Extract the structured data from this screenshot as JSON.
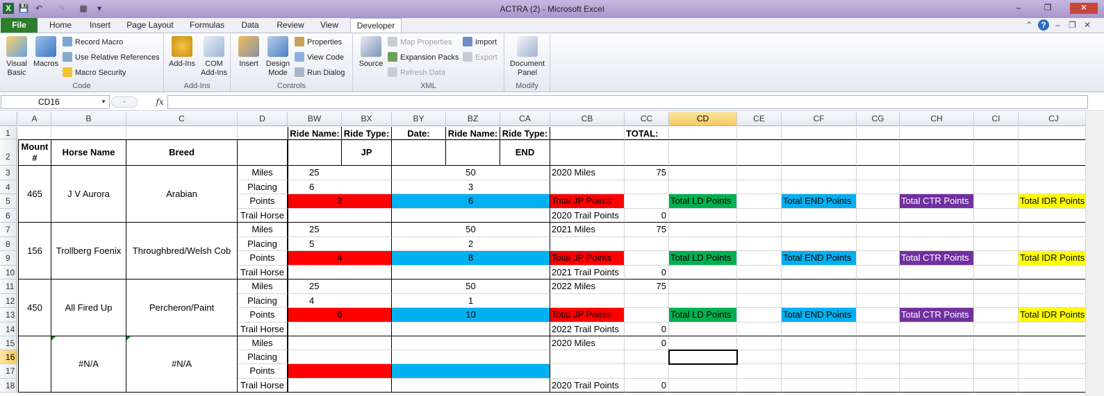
{
  "window": {
    "title": "ACTRA (2)  -  Microsoft Excel"
  },
  "quick_access": {
    "save_icon": "save-icon",
    "undo_icon": "undo-icon",
    "redo_icon": "redo-icon"
  },
  "tabs": [
    "File",
    "Home",
    "Insert",
    "Page Layout",
    "Formulas",
    "Data",
    "Review",
    "View",
    "Developer"
  ],
  "active_tab": "Developer",
  "ribbon": {
    "code": {
      "label": "Code",
      "visual_basic": "Visual\nBasic",
      "macros": "Macros",
      "record_macro": "Record Macro",
      "relative_refs": "Use Relative References",
      "macro_security": "Macro Security"
    },
    "addins": {
      "label": "Add-Ins",
      "addins": "Add-Ins",
      "com_addins": "COM\nAdd-Ins"
    },
    "controls": {
      "label": "Controls",
      "insert": "Insert",
      "design_mode": "Design\nMode",
      "properties": "Properties",
      "view_code": "View Code",
      "run_dialog": "Run Dialog"
    },
    "xml": {
      "label": "XML",
      "source": "Source",
      "map_properties": "Map Properties",
      "expansion_packs": "Expansion Packs",
      "refresh_data": "Refresh Data",
      "import": "Import",
      "export": "Export"
    },
    "modify": {
      "label": "Modify",
      "document_panel": "Document\nPanel"
    }
  },
  "formula_bar": {
    "name_box": "CD16",
    "fx_label": "fx",
    "formula": ""
  },
  "columns": [
    "A",
    "B",
    "C",
    "D",
    "BW",
    "BX",
    "BY",
    "BZ",
    "CA",
    "CB",
    "CC",
    "CD",
    "CE",
    "CF",
    "CG",
    "CH",
    "CI",
    "CJ"
  ],
  "rows": [
    "1",
    "2",
    "3",
    "4",
    "5",
    "6",
    "7",
    "8",
    "9",
    "10",
    "11",
    "12",
    "13",
    "14",
    "15",
    "16",
    "17",
    "18"
  ],
  "header_row1": {
    "bw": "Ride Name:",
    "bx": "Ride Type:",
    "by": "Date:",
    "bz": "Ride Name:",
    "ca": "Ride Type:",
    "cc": "TOTAL:"
  },
  "header_row2": {
    "a": "Mount #",
    "b": "Horse Name",
    "c": "Breed",
    "bx": "JP",
    "ca": "END"
  },
  "labels": {
    "miles": "Miles",
    "placing": "Placing",
    "points": "Points",
    "trail_horse": "Trail Horse",
    "total_jp": "Total JP Points",
    "total_ld": "Total LD Points",
    "total_end": "Total END Points",
    "total_ctr": "Total CTR Points",
    "total_idr": "Total IDR Points"
  },
  "horses": [
    {
      "mount": "465",
      "name": "J V Aurora",
      "breed": "Arabian",
      "miles_bw": "25",
      "miles_bz": "50",
      "placing_bw": "6",
      "placing_bz": "3",
      "points_bw": "2",
      "points_bz": "6",
      "year_miles": "2020 Miles",
      "year_miles_total": "75",
      "trail_points": "2020 Trail Points",
      "trail_total": "0"
    },
    {
      "mount": "156",
      "name": "Trollberg Foenix",
      "breed": "Throughbred/Welsh Cob",
      "miles_bw": "25",
      "miles_bz": "50",
      "placing_bw": "5",
      "placing_bz": "2",
      "points_bw": "4",
      "points_bz": "8",
      "year_miles": "2021 Miles",
      "year_miles_total": "75",
      "trail_points": "2021 Trail Points",
      "trail_total": "0"
    },
    {
      "mount": "450",
      "name": "All Fired Up",
      "breed": "Percheron/Paint",
      "miles_bw": "25",
      "miles_bz": "50",
      "placing_bw": "4",
      "placing_bz": "1",
      "points_bw": "6",
      "points_bz": "10",
      "year_miles": "2022 Miles",
      "year_miles_total": "75",
      "trail_points": "2022 Trail Points",
      "trail_total": "0"
    },
    {
      "mount": "",
      "name": "#N/A",
      "breed": "#N/A",
      "miles_bw": "",
      "miles_bz": "",
      "placing_bw": "",
      "placing_bz": "",
      "points_bw": "",
      "points_bz": "",
      "year_miles": "2020 Miles",
      "year_miles_total": "0",
      "trail_points": "2020 Trail Points",
      "trail_total": "0"
    }
  ],
  "colors": {
    "jp": "#ff0000",
    "end_points": "#00b0f0",
    "ld": "#00b050",
    "ctr": "#7030a0",
    "idr": "#ffff00",
    "file_tab": "#2d7d2d"
  }
}
